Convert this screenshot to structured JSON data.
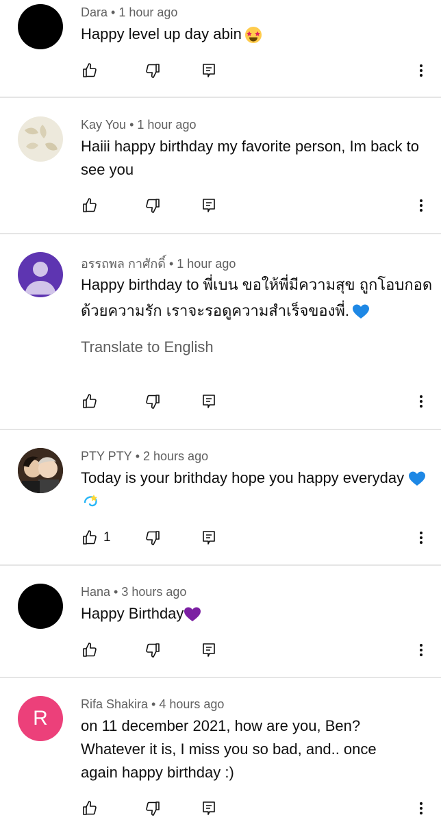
{
  "comments": [
    {
      "author": "Dara",
      "time": "1 hour ago",
      "text": "Happy level up day abin",
      "emoji": "star-struck",
      "like_count": "",
      "avatar": {
        "type": "solid",
        "color": "#000000"
      }
    },
    {
      "author": "Kay You",
      "time": "1 hour ago",
      "text": "Haiii happy birthday my favorite person, Im back to see you",
      "emoji": "",
      "like_count": "",
      "avatar": {
        "type": "pattern",
        "color": "#e8e3d3"
      }
    },
    {
      "author": "อรรถพล กาศักดิ์",
      "time": "1 hour ago",
      "text": "Happy birthday to พี่เบน ขอให้พี่มีความสุข ถูกโอบกอดด้วยความรัก เราจะรอดูความสำเร็จของพี่.",
      "emoji": "blue-heart",
      "translate": "Translate to English",
      "like_count": "",
      "avatar": {
        "type": "default-person",
        "color": "#5e35b1"
      }
    },
    {
      "author": "PTY PTY",
      "time": "2 hours ago",
      "text": "Today is your brithday hope you happy everyday",
      "emoji": "blue-heart dizzy",
      "like_count": "1",
      "avatar": {
        "type": "photo",
        "color": "#3a2a20"
      }
    },
    {
      "author": "Hana",
      "time": "3 hours ago",
      "text": "Happy Birthday",
      "emoji": "purple-heart",
      "like_count": "",
      "avatar": {
        "type": "solid",
        "color": "#000000"
      }
    },
    {
      "author": "Rifa Shakira",
      "time": "4 hours ago",
      "text": "on 11 december 2021, how are you, Ben? Whatever it is, I miss you so bad, and.. once again happy birthday :)",
      "emoji": "",
      "like_count": "",
      "avatar": {
        "type": "letter",
        "letter": "R",
        "color": "#ec407a"
      }
    }
  ],
  "meta_separator": "•",
  "colors": {
    "text": "#0f0f0f",
    "secondary": "#606060",
    "divider": "#e5e5e5"
  }
}
